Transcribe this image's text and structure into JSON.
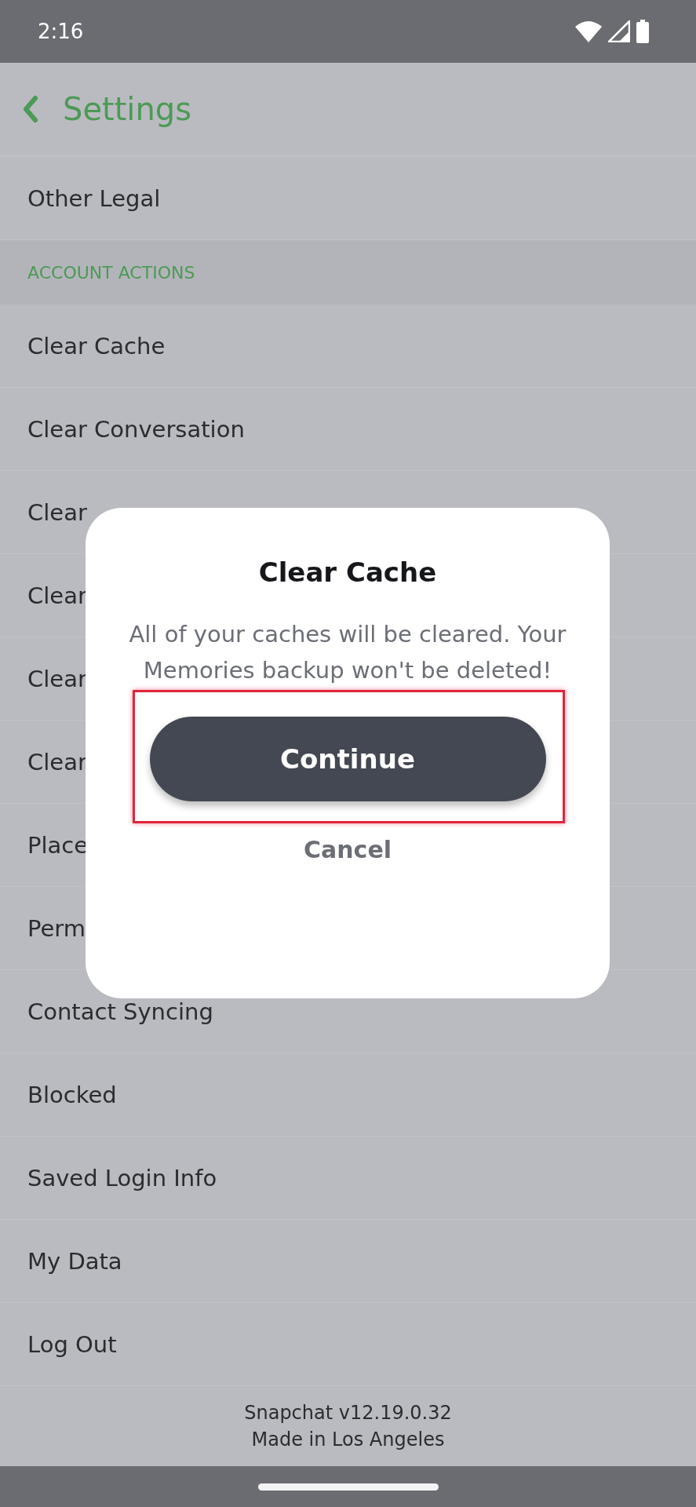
{
  "status_bar": {
    "time": "2:16"
  },
  "header": {
    "title": "Settings"
  },
  "rows": [
    {
      "kind": "item",
      "label": "Other Legal"
    },
    {
      "kind": "section",
      "label": "ACCOUNT ACTIONS"
    },
    {
      "kind": "item",
      "label": "Clear Cache"
    },
    {
      "kind": "item",
      "label": "Clear Conversation"
    },
    {
      "kind": "item",
      "label": "Clear"
    },
    {
      "kind": "item",
      "label": "Clear"
    },
    {
      "kind": "item",
      "label": "Clear"
    },
    {
      "kind": "item",
      "label": "Clear"
    },
    {
      "kind": "item",
      "label": "Place"
    },
    {
      "kind": "item",
      "label": "Perm"
    },
    {
      "kind": "item",
      "label": "Contact Syncing"
    },
    {
      "kind": "item",
      "label": "Blocked"
    },
    {
      "kind": "item",
      "label": "Saved Login Info"
    },
    {
      "kind": "item",
      "label": "My Data"
    },
    {
      "kind": "item",
      "label": "Log Out"
    }
  ],
  "footer": [
    "Snapchat v12.19.0.32",
    "Made in Los Angeles"
  ],
  "dialog": {
    "title": "Clear Cache",
    "message": "All of your caches will be cleared. Your Memories backup won't be deleted!",
    "primary_button": {
      "label": "Continue",
      "highlighted": true
    },
    "secondary_button": "Cancel"
  }
}
